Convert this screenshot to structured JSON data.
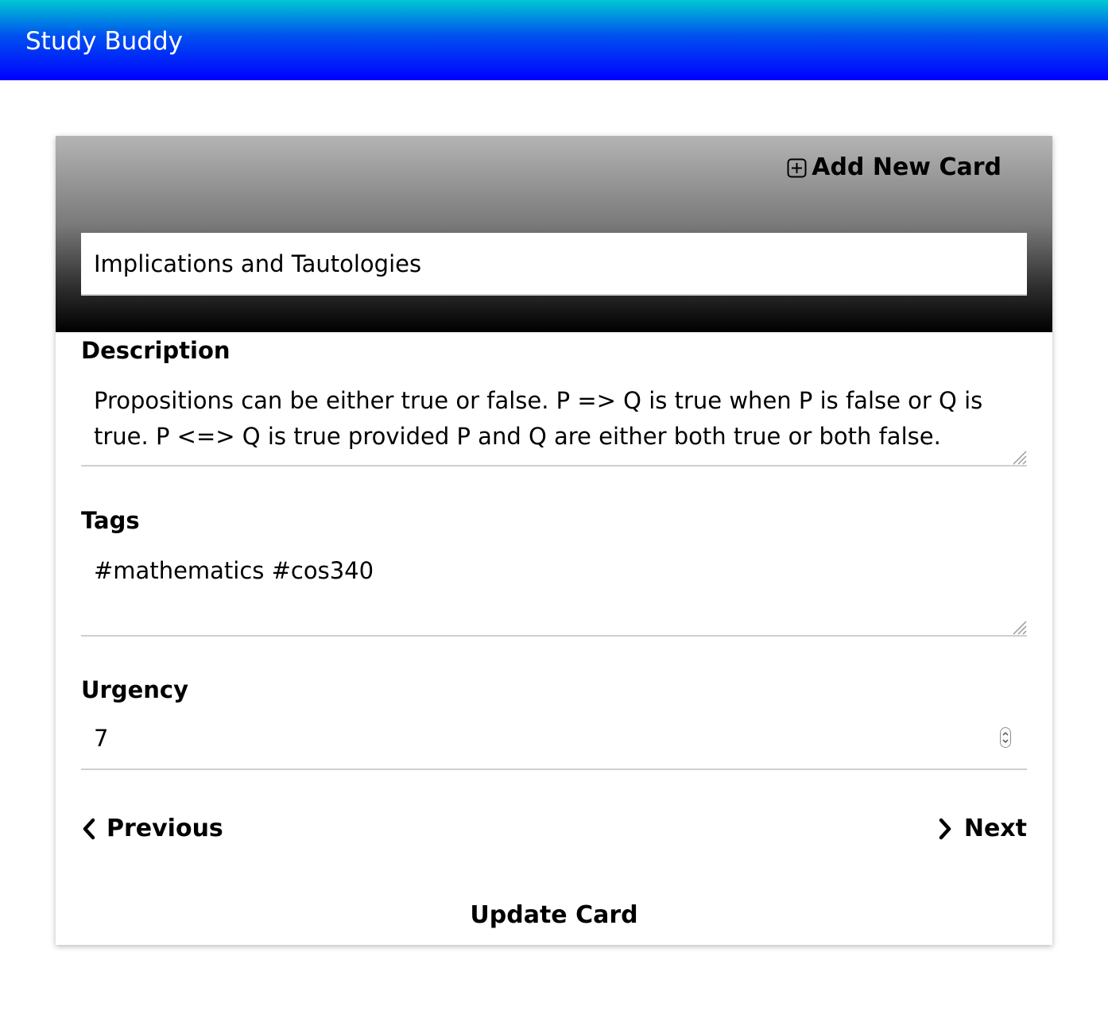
{
  "header": {
    "app_title": "Study Buddy"
  },
  "card": {
    "add_new_label": "Add New Card",
    "title_value": "Implications and Tautologies",
    "description_label": "Description",
    "description_value": "Propositions can be either true or false. P => Q is true when P is false or Q is true. P <=> Q is true provided P and Q are either both true or both false.",
    "tags_label": "Tags",
    "tags_value": "#mathematics #cos340",
    "urgency_label": "Urgency",
    "urgency_value": "7",
    "previous_label": "Previous",
    "next_label": "Next",
    "update_label": "Update Card"
  },
  "icons": {
    "add": "plus-square-icon",
    "previous": "chevron-left-icon",
    "next": "chevron-right-icon",
    "stepper": "number-stepper-icon",
    "resize": "resize-grip-icon"
  },
  "colors": {
    "topbar_top": "#00c8d2",
    "topbar_bottom": "#0000ff",
    "card_head_top": "#b4b4b4",
    "card_head_bottom": "#000000",
    "app_title_text": "#ffffff",
    "text": "#000000"
  }
}
